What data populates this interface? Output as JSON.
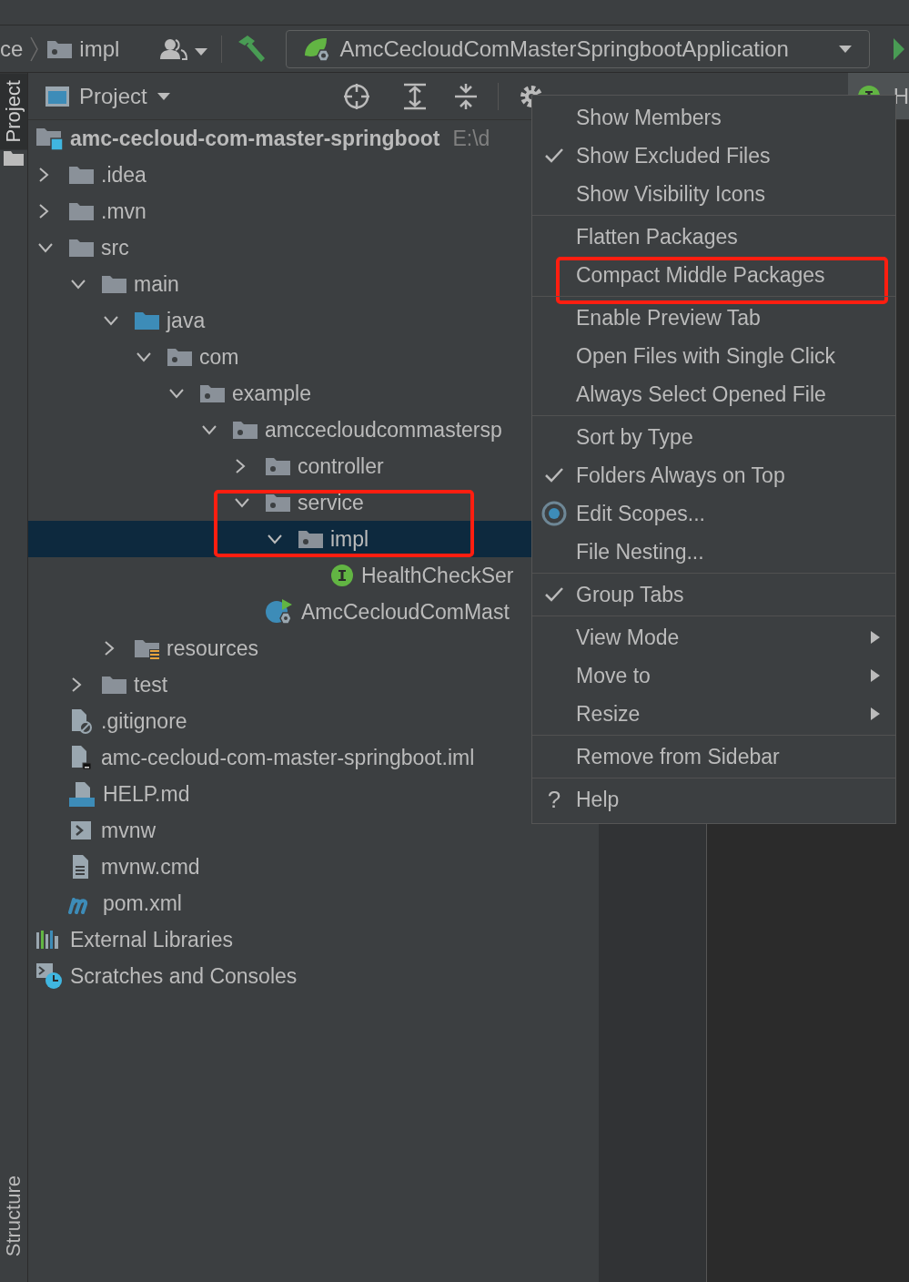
{
  "toolbar": {
    "breadcrumbs": [
      {
        "label": "ce",
        "kind": "text"
      },
      {
        "label": "impl",
        "kind": "package"
      }
    ],
    "run_config": {
      "label": "AmcCecloudComMasterSpringbootApplication"
    }
  },
  "side_stripe": {
    "top_tab": "Project",
    "bottom_tab": "Structure"
  },
  "project_panel": {
    "title": "Project"
  },
  "tree": [
    {
      "label": "amc-cecloud-com-master-springboot",
      "path": "E:\\d",
      "kind": "module",
      "selected": false,
      "children": [
        {
          "label": ".idea",
          "kind": "folder",
          "expanded": false,
          "selected": false
        },
        {
          "label": ".mvn",
          "kind": "folder",
          "expanded": false,
          "selected": false
        },
        {
          "label": "src",
          "kind": "folder",
          "expanded": true,
          "selected": false,
          "children": [
            {
              "label": "main",
              "kind": "folder",
              "expanded": true,
              "selected": false,
              "children": [
                {
                  "label": "java",
                  "kind": "source-root",
                  "expanded": true,
                  "selected": false,
                  "children": [
                    {
                      "label": "com",
                      "kind": "package",
                      "expanded": true,
                      "selected": false,
                      "children": [
                        {
                          "label": "example",
                          "kind": "package",
                          "expanded": true,
                          "selected": false,
                          "children": [
                            {
                              "label": "amccecloudcommastersp",
                              "kind": "package",
                              "expanded": true,
                              "selected": false,
                              "children": [
                                {
                                  "label": "controller",
                                  "kind": "package",
                                  "expanded": false,
                                  "selected": false
                                },
                                {
                                  "label": "service",
                                  "kind": "package",
                                  "expanded": true,
                                  "selected": false,
                                  "highlighted": true,
                                  "children": [
                                    {
                                      "label": "impl",
                                      "kind": "package",
                                      "expanded": true,
                                      "selected": true,
                                      "highlighted": true,
                                      "children": [
                                        {
                                          "label": "HealthCheckSer",
                                          "kind": "interface",
                                          "selected": false
                                        }
                                      ]
                                    }
                                  ]
                                },
                                {
                                  "label": "AmcCecloudComMast",
                                  "kind": "spring-class",
                                  "selected": false
                                }
                              ]
                            }
                          ]
                        }
                      ]
                    }
                  ]
                },
                {
                  "label": "resources",
                  "kind": "resources-root",
                  "expanded": false,
                  "selected": false
                }
              ]
            },
            {
              "label": "test",
              "kind": "folder",
              "expanded": false,
              "selected": false
            }
          ]
        },
        {
          "label": ".gitignore",
          "kind": "ignore-file",
          "selected": false
        },
        {
          "label": "amc-cecloud-com-master-springboot.iml",
          "kind": "iml-file",
          "selected": false
        },
        {
          "label": "HELP.md",
          "kind": "markdown-file",
          "selected": false
        },
        {
          "label": "mvnw",
          "kind": "shell-file",
          "selected": false
        },
        {
          "label": "mvnw.cmd",
          "kind": "text-file",
          "selected": false
        },
        {
          "label": "pom.xml",
          "kind": "maven-file",
          "selected": false
        }
      ]
    },
    {
      "label": "External Libraries",
      "kind": "libraries",
      "selected": false
    },
    {
      "label": "Scratches and Consoles",
      "kind": "scratches",
      "selected": false
    }
  ],
  "editor_tabs": [
    {
      "label": "H",
      "kind": "interface"
    }
  ],
  "menu": {
    "groups": [
      {
        "items": [
          {
            "label": "Show Members",
            "kind": "plain",
            "checked": false,
            "submenu": false
          },
          {
            "label": "Show Excluded Files",
            "kind": "plain",
            "checked": true,
            "submenu": false
          },
          {
            "label": "Show Visibility Icons",
            "kind": "plain",
            "checked": false,
            "submenu": false
          }
        ]
      },
      {
        "items": [
          {
            "label": "Flatten Packages",
            "kind": "plain",
            "checked": false,
            "submenu": false
          },
          {
            "label": "Compact Middle Packages",
            "kind": "plain",
            "checked": false,
            "submenu": false,
            "highlighted": true
          }
        ]
      },
      {
        "items": [
          {
            "label": "Enable Preview Tab",
            "kind": "plain",
            "checked": false,
            "submenu": false
          },
          {
            "label": "Open Files with Single Click",
            "kind": "plain",
            "checked": false,
            "submenu": false
          },
          {
            "label": "Always Select Opened File",
            "kind": "plain",
            "checked": false,
            "submenu": false
          }
        ]
      },
      {
        "items": [
          {
            "label": "Sort by Type",
            "kind": "plain",
            "checked": false,
            "submenu": false
          },
          {
            "label": "Folders Always on Top",
            "kind": "plain",
            "checked": true,
            "submenu": false
          },
          {
            "label": "Edit Scopes...",
            "kind": "scope",
            "submenu": false
          },
          {
            "label": "File Nesting...",
            "kind": "plain",
            "checked": false,
            "submenu": false
          }
        ]
      },
      {
        "items": [
          {
            "label": "Group Tabs",
            "kind": "plain",
            "checked": true,
            "submenu": false
          }
        ]
      },
      {
        "items": [
          {
            "label": "View Mode",
            "kind": "plain",
            "checked": false,
            "submenu": true
          },
          {
            "label": "Move to",
            "kind": "plain",
            "checked": false,
            "submenu": true
          },
          {
            "label": "Resize",
            "kind": "plain",
            "checked": false,
            "submenu": true
          }
        ]
      },
      {
        "items": [
          {
            "label": "Remove from Sidebar",
            "kind": "plain",
            "checked": false,
            "submenu": false
          }
        ]
      },
      {
        "items": [
          {
            "label": "Help",
            "kind": "help",
            "submenu": false,
            "glyph": "?"
          }
        ]
      }
    ]
  }
}
